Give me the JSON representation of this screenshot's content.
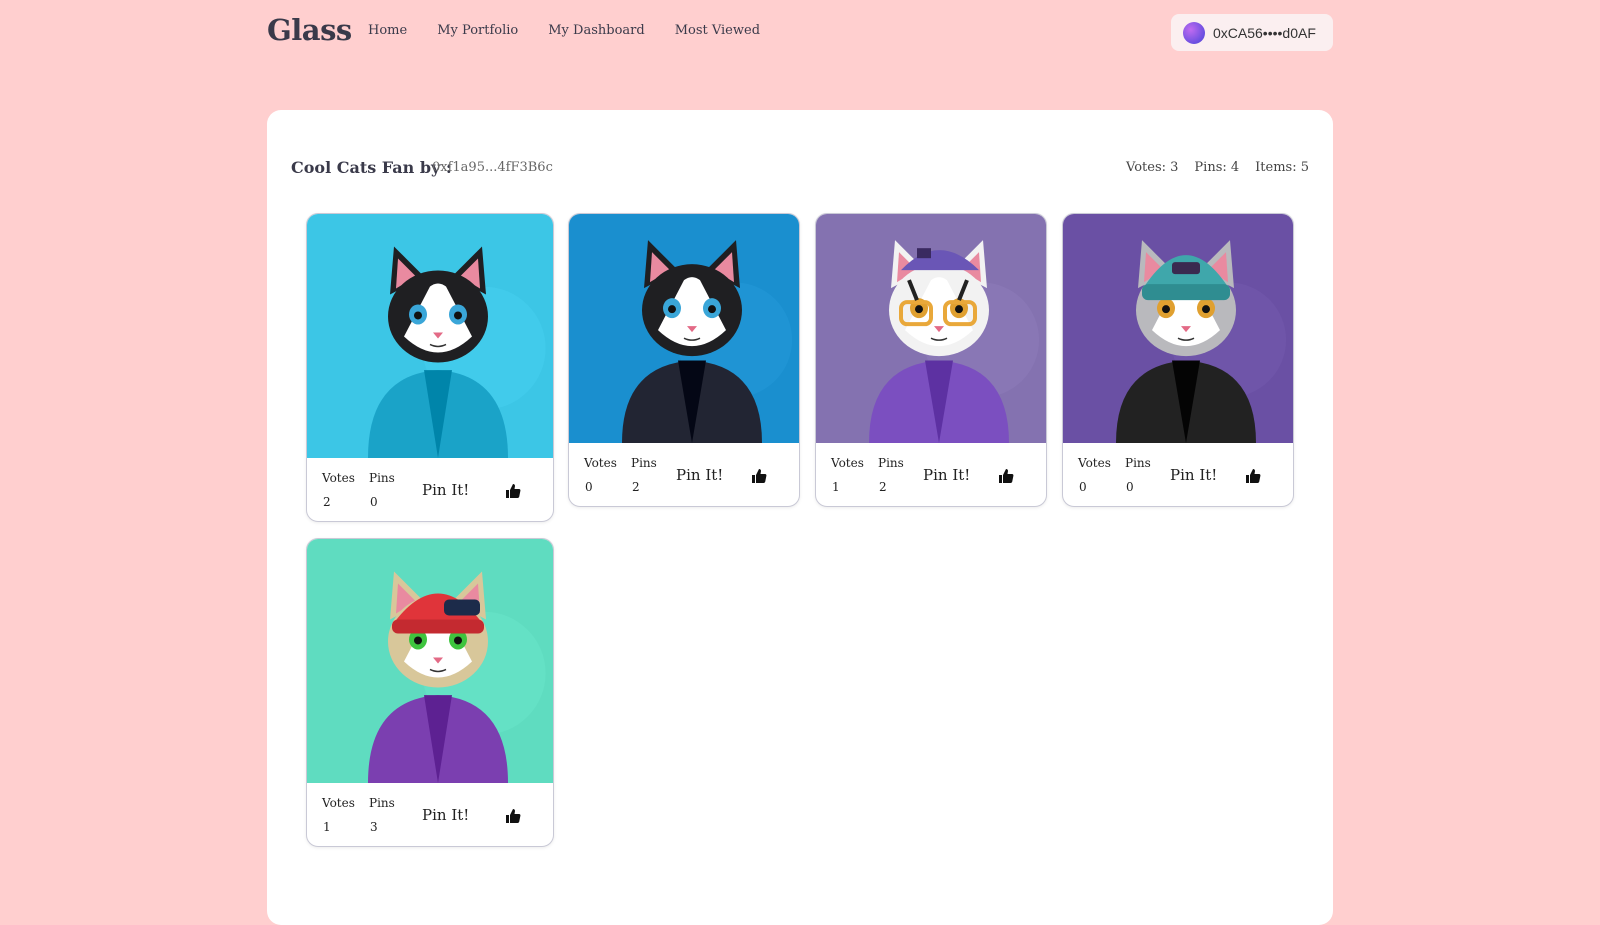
{
  "header": {
    "logo": "Glass",
    "nav": [
      "Home",
      "My Portfolio",
      "My Dashboard",
      "Most Viewed"
    ],
    "wallet": "0xCA56••••d0AF"
  },
  "panel": {
    "title": "Cool Cats Fan by :",
    "address": "0xf1a95...4fF3B6c",
    "stats": [
      "Votes: 3",
      "Pins: 4",
      "Items: 5"
    ]
  },
  "labels": {
    "votes": "Votes",
    "pins": "Pins",
    "pin_button": "Pin It!"
  },
  "colors": {
    "background": "#ffcfcf",
    "panel": "#ffffff"
  },
  "cards": [
    {
      "votes": "2",
      "pins": "0",
      "bg": "#3cc6e6",
      "cat": "black-white",
      "outfit": "#1aa3c8"
    },
    {
      "votes": "0",
      "pins": "2",
      "bg": "#1a8fcf",
      "cat": "black-white-suit",
      "outfit": "#222533"
    },
    {
      "votes": "1",
      "pins": "2",
      "bg": "#8472b0",
      "cat": "tabby-cap-glasses",
      "outfit": "#7b4fc0"
    },
    {
      "votes": "0",
      "pins": "0",
      "bg": "#6a50a4",
      "cat": "grey-beanie",
      "outfit": "#222222"
    },
    {
      "votes": "1",
      "pins": "3",
      "bg": "#5fdcc0",
      "cat": "cream-red-cap",
      "outfit": "#7b3fb0"
    }
  ]
}
